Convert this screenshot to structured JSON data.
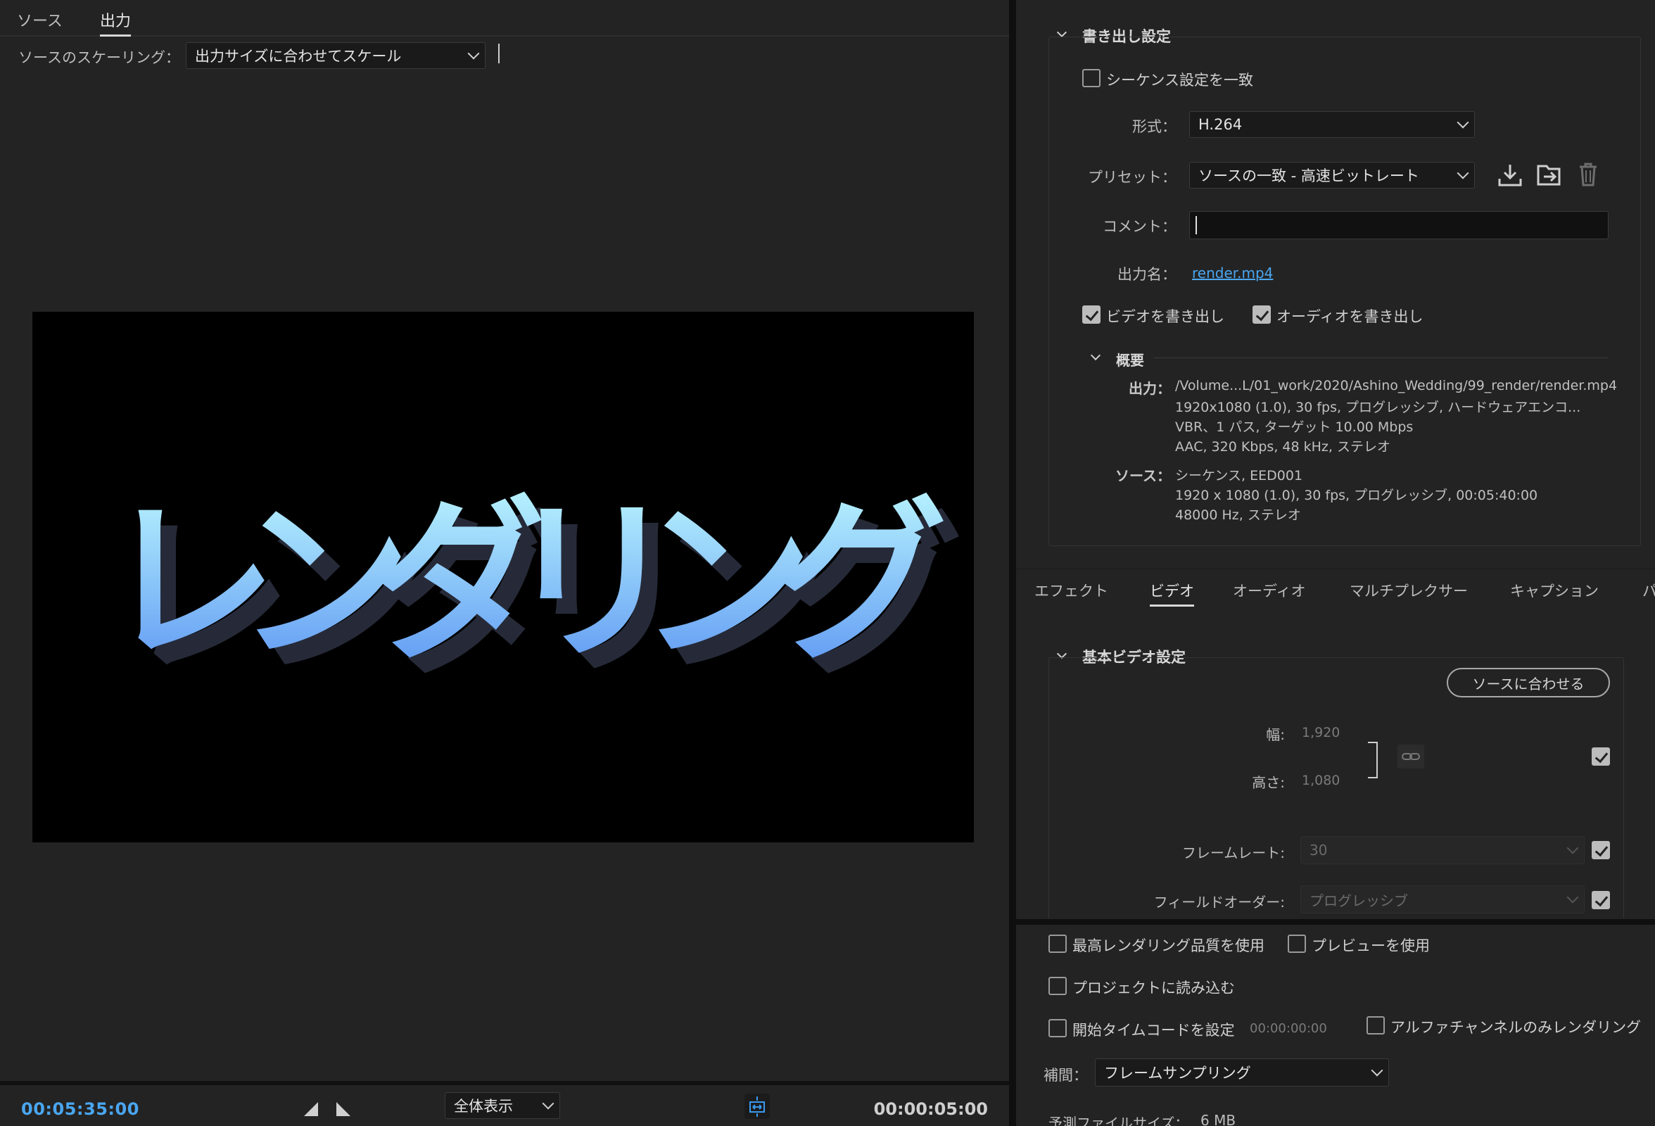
{
  "left": {
    "tabs": [
      {
        "label": "ソース",
        "active": false
      },
      {
        "label": "出力",
        "active": true
      }
    ],
    "scaling": {
      "label": "ソースのスケーリング：",
      "value": "出力サイズに合わせてスケール"
    },
    "preview": {
      "text": "レンダリング",
      "colors": {
        "top": "#baf6ff",
        "bottom": "#5a93f2",
        "shadow": "#262a38"
      }
    },
    "bottom": {
      "timecode_current": "00:05:35:00",
      "zoom": "全体表示",
      "timecode_duration": "00:00:05:00"
    }
  },
  "export_settings": {
    "title": "書き出し設定",
    "match_sequence": {
      "label": "シーケンス設定を一致",
      "checked": false
    },
    "format": {
      "label": "形式：",
      "value": "H.264"
    },
    "preset": {
      "label": "プリセット：",
      "value": "ソースの一致 - 高速ビットレート"
    },
    "comment": {
      "label": "コメント：",
      "value": ""
    },
    "output_name": {
      "label": "出力名：",
      "value": "render.mp4"
    },
    "export_video": {
      "label": "ビデオを書き出し",
      "checked": true
    },
    "export_audio": {
      "label": "オーディオを書き出し",
      "checked": true
    },
    "summary": {
      "title": "概要",
      "output_label": "出力：",
      "output_lines": [
        "/Volume...L/01_work/2020/Ashino_Wedding/99_render/render.mp4",
        "1920x1080 (1.0), 30 fps, プログレッシブ, ハードウェアエンコ...",
        "VBR、1 パス, ターゲット 10.00 Mbps",
        "AAC, 320 Kbps, 48 kHz, ステレオ"
      ],
      "source_label": "ソース：",
      "source_lines": [
        "シーケンス, EED001",
        "1920 x 1080 (1.0), 30 fps, プログレッシブ, 00:05:40:00",
        "48000 Hz, ステレオ"
      ]
    }
  },
  "settings_tabs": [
    {
      "label": "エフェクト",
      "active": false
    },
    {
      "label": "ビデオ",
      "active": true
    },
    {
      "label": "オーディオ",
      "active": false
    },
    {
      "label": "マルチプレクサー",
      "active": false
    },
    {
      "label": "キャプション",
      "active": false
    },
    {
      "label": "パ",
      "active": false
    }
  ],
  "basic_video": {
    "title": "基本ビデオ設定",
    "match_source_button": "ソースに合わせる",
    "width": {
      "label": "幅:",
      "value": "1,920"
    },
    "height": {
      "label": "高さ:",
      "value": "1,080"
    },
    "frame_rate": {
      "label": "フレームレート:",
      "value": "30",
      "checked": true
    },
    "field_order": {
      "label": "フィールドオーダー:",
      "value": "プログレッシブ",
      "checked": true
    },
    "size_checked": true
  },
  "footer_options": {
    "max_quality": {
      "label": "最高レンダリング品質を使用",
      "checked": false
    },
    "use_preview": {
      "label": "プレビューを使用",
      "checked": false
    },
    "import_project": {
      "label": "プロジェクトに読み込む",
      "checked": false
    },
    "start_timecode": {
      "label": "開始タイムコードを設定",
      "value": "00:00:00:00",
      "checked": false
    },
    "alpha_only": {
      "label": "アルファチャンネルのみレンダリング",
      "checked": false
    },
    "interpolation": {
      "label": "補間：",
      "value": "フレームサンプリング"
    },
    "estimated_size": {
      "label": "予測ファイルサイズ：",
      "value": "6 MB"
    }
  }
}
